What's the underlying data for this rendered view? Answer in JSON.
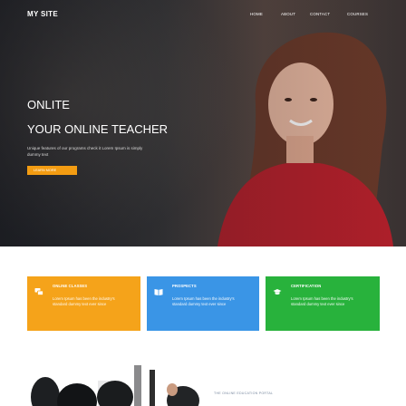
{
  "brand": {
    "name": "MY SITE"
  },
  "nav": [
    {
      "label": "HOME"
    },
    {
      "label": "ABOUT"
    },
    {
      "label": "CONTACT"
    },
    {
      "label": "COURSES"
    }
  ],
  "hero": {
    "title_line1": "ONLITE",
    "title_line2": "YOUR ONLINE TEACHER",
    "description": "Unique features of our programs check it Lorem Ipsum is simply dummy text",
    "button_label": "LEARN MORE"
  },
  "cards": [
    {
      "title": "ONLINE CLASSES",
      "text": "Lorem Ipsum has been the industry's standard dummy text ever since",
      "color": "#f5a31a",
      "icon": "chat-bubbles-icon"
    },
    {
      "title": "PROSPECTS",
      "text": "Lorem Ipsum has been the industry's standard dummy text ever since",
      "color": "#3a95e6",
      "icon": "book-icon"
    },
    {
      "title": "CERTIFICATION",
      "text": "Lorem Ipsum has been the industry's standard dummy text ever since",
      "color": "#28b23c",
      "icon": "graduation-cap-icon"
    }
  ],
  "section": {
    "heading": "THE ONLINE EDUCATION PORTAL"
  }
}
